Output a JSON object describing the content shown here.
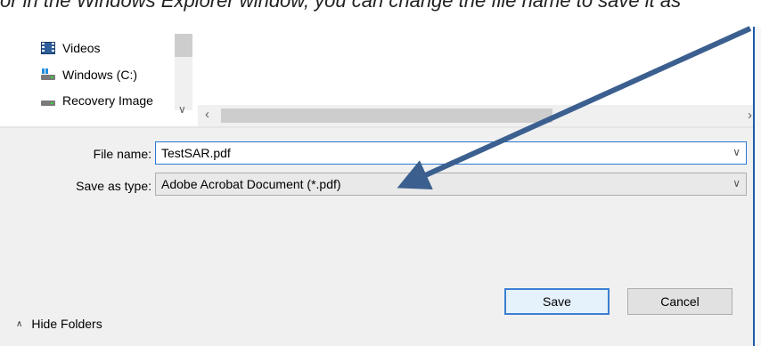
{
  "caption": {
    "text": "or in the Windows Explorer window, you can change the file name to save it as"
  },
  "tree": {
    "items": [
      {
        "label": "Videos",
        "icon": "video-folder-icon"
      },
      {
        "label": "Windows (C:)",
        "icon": "windows-drive-icon"
      },
      {
        "label": "Recovery Image",
        "icon": "drive-icon"
      }
    ]
  },
  "form": {
    "file_name_label": "File name:",
    "file_name_value": "TestSAR.pdf",
    "save_type_label": "Save as type:",
    "save_type_value": "Adobe Acrobat Document (*.pdf)"
  },
  "buttons": {
    "save": "Save",
    "cancel": "Cancel"
  },
  "hide_folders": "Hide Folders",
  "colors": {
    "arrow": "#3b5f8f",
    "accent": "#2a78d4"
  }
}
